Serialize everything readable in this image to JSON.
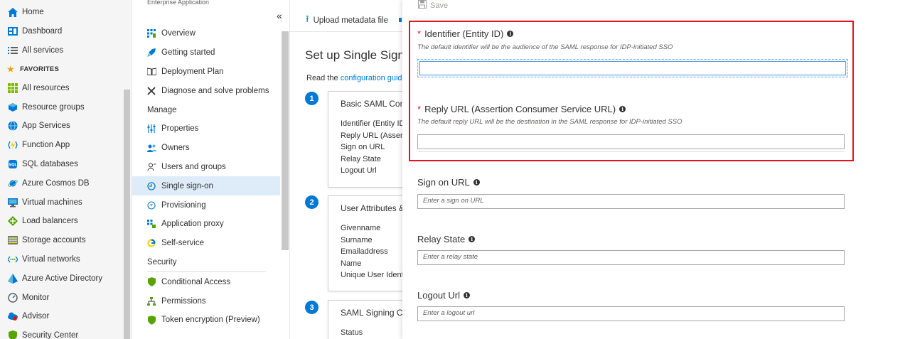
{
  "leftnav": {
    "items": [
      {
        "label": "Home",
        "icon": "home-icon"
      },
      {
        "label": "Dashboard",
        "icon": "dashboard-icon"
      },
      {
        "label": "All services",
        "icon": "list-icon"
      }
    ],
    "favorites_label": "FAVORITES",
    "favorites": [
      {
        "label": "All resources",
        "icon": "grid-icon"
      },
      {
        "label": "Resource groups",
        "icon": "cube-icon"
      },
      {
        "label": "App Services",
        "icon": "globe-icon"
      },
      {
        "label": "Function App",
        "icon": "lightning-icon"
      },
      {
        "label": "SQL databases",
        "icon": "sql-icon"
      },
      {
        "label": "Azure Cosmos DB",
        "icon": "planet-icon"
      },
      {
        "label": "Virtual machines",
        "icon": "monitor-icon"
      },
      {
        "label": "Load balancers",
        "icon": "diamond-icon"
      },
      {
        "label": "Storage accounts",
        "icon": "storage-icon"
      },
      {
        "label": "Virtual networks",
        "icon": "network-icon"
      },
      {
        "label": "Azure Active Directory",
        "icon": "pyramid-icon"
      },
      {
        "label": "Monitor",
        "icon": "gauge-icon"
      },
      {
        "label": "Advisor",
        "icon": "cloud-icon"
      },
      {
        "label": "Security Center",
        "icon": "shield-icon"
      }
    ]
  },
  "resmenu": {
    "subtitle": "Enterprise Application",
    "collapse_label": "«",
    "top_items": [
      {
        "label": "Overview",
        "icon": "overview-icon"
      },
      {
        "label": "Getting started",
        "icon": "rocket-icon"
      },
      {
        "label": "Deployment Plan",
        "icon": "book-icon"
      },
      {
        "label": "Diagnose and solve problems",
        "icon": "wrench-icon"
      }
    ],
    "manage_label": "Manage",
    "manage_items": [
      {
        "label": "Properties",
        "icon": "sliders-icon"
      },
      {
        "label": "Owners",
        "icon": "people-icon"
      },
      {
        "label": "Users and groups",
        "icon": "user-icon"
      },
      {
        "label": "Single sign-on",
        "icon": "sso-icon",
        "selected": true
      },
      {
        "label": "Provisioning",
        "icon": "provision-icon"
      },
      {
        "label": "Application proxy",
        "icon": "proxy-icon"
      },
      {
        "label": "Self-service",
        "icon": "google-icon"
      }
    ],
    "security_label": "Security",
    "security_items": [
      {
        "label": "Conditional Access",
        "icon": "shield-icon"
      },
      {
        "label": "Permissions",
        "icon": "tree-icon"
      },
      {
        "label": "Token encryption (Preview)",
        "icon": "shield-icon"
      }
    ]
  },
  "main": {
    "upload_label": "Upload metadata file",
    "page_title": "Set up Single Sign-O",
    "read_prefix": "Read the ",
    "read_link": "configuration guide",
    "steps": [
      {
        "number": "1",
        "title": "Basic SAML Confi",
        "rows": [
          "Identifier (Entity ID",
          "Reply URL (Assertio",
          "Sign on URL",
          "Relay State",
          "Logout Url"
        ]
      },
      {
        "number": "2",
        "title": "User Attributes &",
        "rows": [
          "Givenname",
          "Surname",
          "Emailaddress",
          "Name",
          "Unique User Identi"
        ]
      },
      {
        "number": "3",
        "title": "SAML Signing Ce",
        "rows": [
          "Status"
        ]
      }
    ]
  },
  "blade": {
    "save_label": "Save",
    "identifier": {
      "label": "Identifier (Entity ID)",
      "help": "The default identifier will be the audience of the SAML response for IDP-initiated SSO",
      "value": ""
    },
    "reply_url": {
      "label": "Reply URL (Assertion Consumer Service URL)",
      "help": "The default reply URL will be the destination in the SAML response for IDP-initiated SSO",
      "value": ""
    },
    "sign_on_url": {
      "label": "Sign on URL",
      "placeholder": "Enter a sign on URL"
    },
    "relay_state": {
      "label": "Relay State",
      "placeholder": "Enter a relay state"
    },
    "logout_url": {
      "label": "Logout Url",
      "placeholder": "Enter a logout url"
    },
    "required_mark": "*",
    "info_glyph": "i",
    "highlight_color": "#e3141d",
    "accent_color": "#0078d4"
  }
}
